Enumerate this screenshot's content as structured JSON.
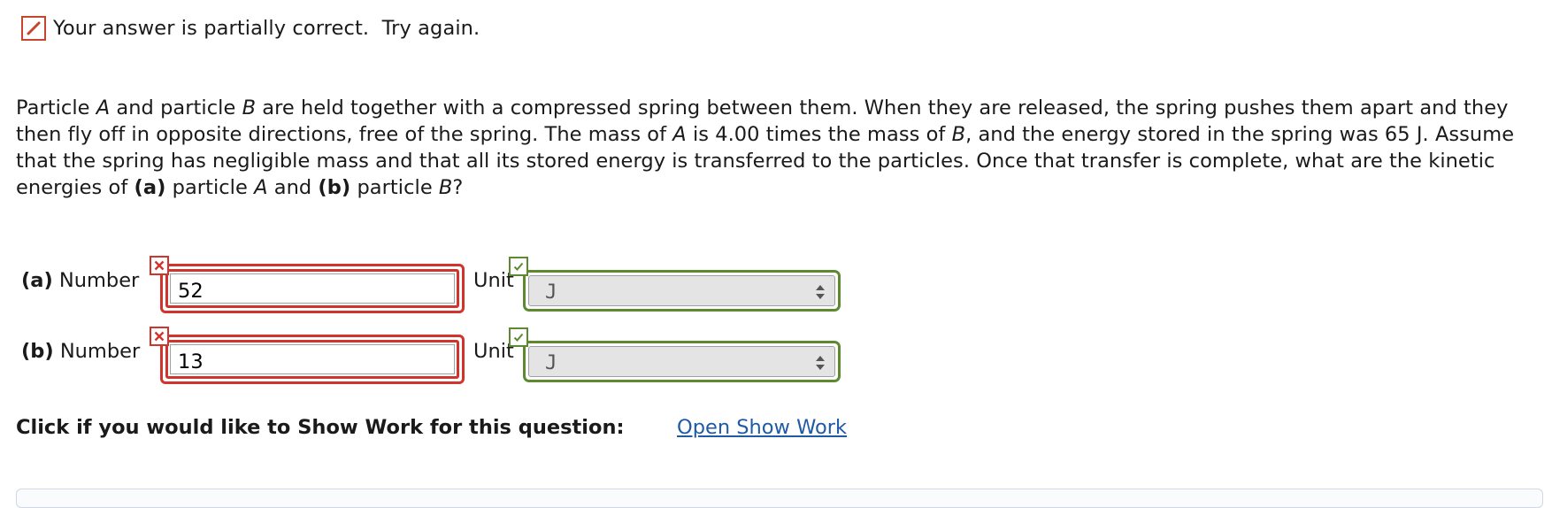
{
  "feedback": {
    "status_text": "Your answer is partially correct.  Try again.",
    "icon": "pencil-edit-icon",
    "color": "#c8442b"
  },
  "question": {
    "s1": "Particle ",
    "a1": "A",
    "s2": " and particle ",
    "b1": "B",
    "s3": " are held together with a compressed spring between them. When they are released, the spring pushes them apart and they then fly off in opposite directions, free of the spring. The mass of ",
    "a2": "A",
    "s4": " is 4.00 times the mass of ",
    "b2": "B",
    "s5": ", and the energy stored in the spring was 65 J. Assume that the spring has negligible mass and that all its stored energy is transferred to the particles. Once that transfer is complete, what are the kinetic energies of ",
    "part_a": "(a)",
    "s6": " particle ",
    "a3": "A",
    "s7": " and ",
    "part_b": "(b)",
    "s8": " particle ",
    "b3": "B",
    "s9": "?"
  },
  "answers": [
    {
      "part": "(a)",
      "number_label": "Number",
      "value": "52",
      "number_status": "incorrect",
      "unit_label": "Unit",
      "unit_value": "J",
      "unit_status": "correct"
    },
    {
      "part": "(b)",
      "number_label": "Number",
      "value": "13",
      "number_status": "incorrect",
      "unit_label": "Unit",
      "unit_value": "J",
      "unit_status": "correct"
    }
  ],
  "show_work": {
    "label": "Click if you would like to Show Work for this question:",
    "link": "Open Show Work"
  },
  "colors": {
    "incorrect": "#d0342c",
    "correct": "#5d8a2e",
    "link": "#1f5aa6"
  }
}
